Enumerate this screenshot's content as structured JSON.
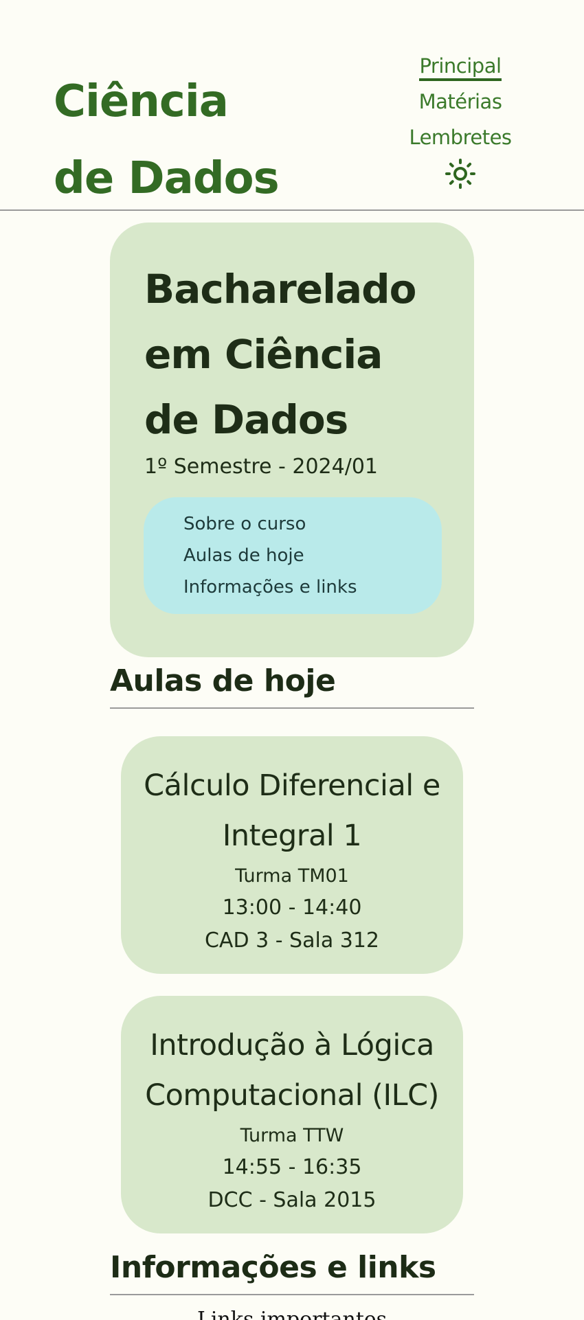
{
  "header": {
    "site_title": "Ciência de Dados",
    "nav": [
      {
        "label": "Principal",
        "active": true
      },
      {
        "label": "Matérias",
        "active": false
      },
      {
        "label": "Lembretes",
        "active": false
      }
    ],
    "theme_icon": "sun-icon"
  },
  "hero": {
    "title": "Bacharelado em Ciência de Dados",
    "subtitle": "1º Semestre - 2024/01",
    "menu": [
      "Sobre o curso",
      "Aulas de hoje",
      "Informações e links"
    ]
  },
  "today": {
    "section_title": "Aulas de hoje",
    "classes": [
      {
        "name": "Cálculo Diferencial e Integral 1",
        "turma": "Turma TM01",
        "time": "13:00 - 14:40",
        "room": "CAD 3 - Sala 312"
      },
      {
        "name": "Introdução à Lógica Computacional (ILC)",
        "turma": "Turma TTW",
        "time": "14:55 - 16:35",
        "room": "DCC - Sala 2015"
      }
    ]
  },
  "info": {
    "section_title": "Informações e links",
    "partial_text": "Links importantes"
  },
  "colors": {
    "background": "#fdfdf6",
    "brand_green": "#336b24",
    "card_green": "#d8e8cb",
    "menu_cyan": "#b9eaea"
  }
}
